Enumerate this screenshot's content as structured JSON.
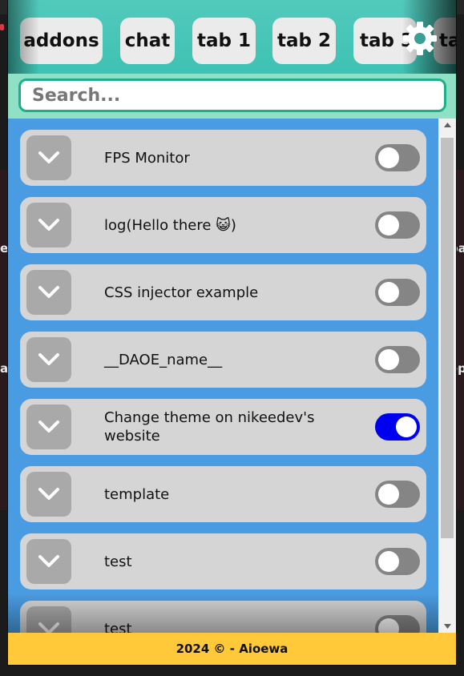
{
  "tabs": [
    {
      "label": "addons"
    },
    {
      "label": "chat"
    },
    {
      "label": "tab 1"
    },
    {
      "label": "tab 2"
    },
    {
      "label": "tab 3"
    },
    {
      "label": "ta"
    }
  ],
  "search": {
    "placeholder": "Search...",
    "value": ""
  },
  "background_edge_text": {
    "left_1": "e",
    "right_1": "pa",
    "left_2": "a",
    "right_2": "ep"
  },
  "addons": [
    {
      "name": "FPS Monitor",
      "enabled": false
    },
    {
      "name": "log(Hello there 😺)",
      "enabled": false
    },
    {
      "name": "CSS injector example",
      "enabled": false
    },
    {
      "name": "__DAOE_name__",
      "enabled": false
    },
    {
      "name": "Change theme on nikeedev's website",
      "enabled": true
    },
    {
      "name": "template",
      "enabled": false
    },
    {
      "name": "test",
      "enabled": false
    },
    {
      "name": "test",
      "enabled": false
    }
  ],
  "footer": {
    "text": "2024 © - Aioewa"
  },
  "colors": {
    "tabbar": "#3ec2b3",
    "search_band": "#8fe0c4",
    "list_background": "#4a9ce2",
    "item_background": "#d5d5d5",
    "toggle_on": "#0000f0",
    "toggle_off": "#858585",
    "footer": "#ffc93a"
  },
  "icons": {
    "settings": "gear-icon",
    "expand": "chevron-down-icon"
  }
}
